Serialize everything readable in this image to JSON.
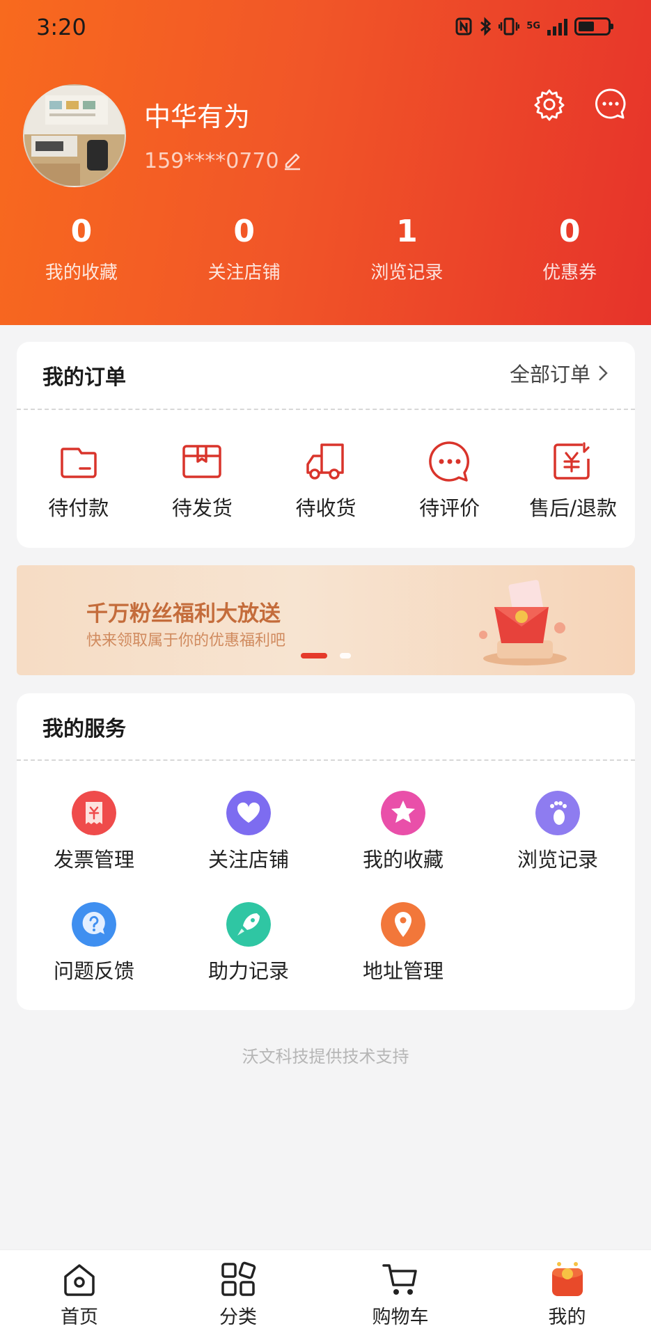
{
  "status_bar": {
    "time": "3:20",
    "network": "5G"
  },
  "profile": {
    "username": "中华有为",
    "phone": "159****0770"
  },
  "stats": [
    {
      "value": "0",
      "label": "我的收藏"
    },
    {
      "value": "0",
      "label": "关注店铺"
    },
    {
      "value": "1",
      "label": "浏览记录"
    },
    {
      "value": "0",
      "label": "优惠券"
    }
  ],
  "orders": {
    "title": "我的订单",
    "all_label": "全部订单",
    "items": [
      {
        "label": "待付款",
        "icon": "wallet-icon"
      },
      {
        "label": "待发货",
        "icon": "package-icon"
      },
      {
        "label": "待收货",
        "icon": "truck-icon"
      },
      {
        "label": "待评价",
        "icon": "comment-icon"
      },
      {
        "label": "售后/退款",
        "icon": "refund-icon"
      }
    ]
  },
  "banner": {
    "title": "千万粉丝福利大放送",
    "subtitle": "快来领取属于你的优惠福利吧"
  },
  "services": {
    "title": "我的服务",
    "items": [
      {
        "label": "发票管理",
        "icon": "invoice-icon",
        "color": "#ef4b4b"
      },
      {
        "label": "关注店铺",
        "icon": "heart-icon",
        "color": "#7d6cf0"
      },
      {
        "label": "我的收藏",
        "icon": "star-icon",
        "color": "#e94fa9"
      },
      {
        "label": "浏览记录",
        "icon": "footprint-icon",
        "color": "#8e7cf0"
      },
      {
        "label": "问题反馈",
        "icon": "question-icon",
        "color": "#3f8ff0"
      },
      {
        "label": "助力记录",
        "icon": "rocket-icon",
        "color": "#2fc6a3"
      },
      {
        "label": "地址管理",
        "icon": "location-pin-icon",
        "color": "#f2773a"
      }
    ]
  },
  "footer_note": "沃文科技提供技术支持",
  "bottom_nav": [
    {
      "label": "首页",
      "icon": "home-icon",
      "active": false
    },
    {
      "label": "分类",
      "icon": "category-icon",
      "active": false
    },
    {
      "label": "购物车",
      "icon": "cart-icon",
      "active": false
    },
    {
      "label": "我的",
      "icon": "mine-icon",
      "active": true
    }
  ],
  "colors": {
    "header_start": "#f86a1e",
    "header_end": "#e6332a",
    "accent": "#e53a2a",
    "icon_red": "#d9342b"
  }
}
